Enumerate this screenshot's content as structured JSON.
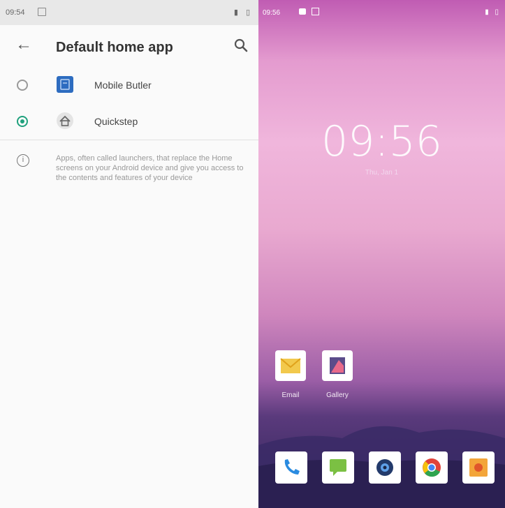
{
  "left_status": {
    "time": "09:54",
    "right_icons": "▮ ▯"
  },
  "appbar": {
    "back_icon": "arrow-left-icon",
    "title": "Default home app",
    "search_icon": "search-icon"
  },
  "options": [
    {
      "label": "Mobile Butler",
      "selected": false,
      "icon": "mobile-butler-icon"
    },
    {
      "label": "Quickstep",
      "selected": true,
      "icon": "quickstep-home-icon"
    }
  ],
  "info": {
    "icon_glyph": "i",
    "text": "Apps, often called launchers, that replace the Home screens on your Android device and give you access to the contents and features of your device"
  },
  "home": {
    "status_time": "09:56",
    "status_right": "▮ ▯",
    "clock": "09:56",
    "date": "Thu, Jan 1",
    "apps": [
      {
        "label": "Email"
      },
      {
        "label": "Gallery"
      }
    ],
    "dock": [
      "phone-icon",
      "messaging-icon",
      "camera-icon",
      "chrome-icon",
      "music-icon"
    ]
  },
  "colors": {
    "accent": "#1fa17d"
  }
}
